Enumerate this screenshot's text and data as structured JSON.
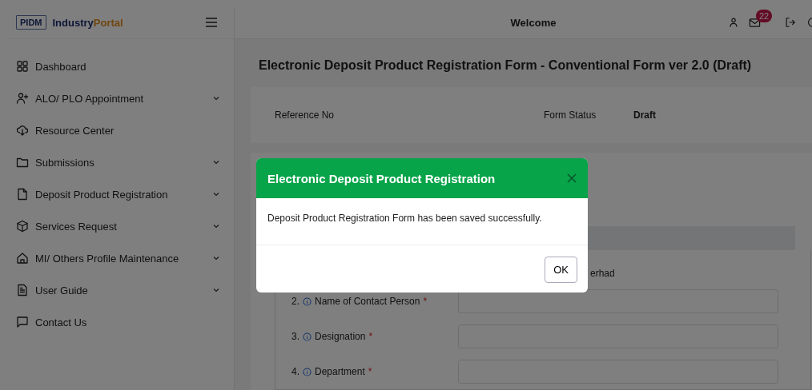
{
  "brand": {
    "mark": "PIDM",
    "name": "Industry",
    "accent": "Portal"
  },
  "header": {
    "welcome": "Welcome",
    "badge": "22"
  },
  "sidebar": {
    "items": [
      {
        "label": "Dashboard",
        "kind": "link"
      },
      {
        "label": "ALO/ PLO Appointment",
        "kind": "menu",
        "expanded": false
      },
      {
        "label": "Resource Center",
        "kind": "link"
      },
      {
        "label": "Submissions",
        "kind": "menu",
        "expanded": false
      },
      {
        "label": "Deposit Product Registration",
        "kind": "menu",
        "expanded": false
      },
      {
        "label": "Services Request",
        "kind": "menu",
        "expanded": false
      },
      {
        "label": "MI/ Others Profile Maintenance",
        "kind": "menu",
        "expanded": false
      },
      {
        "label": "User Guide",
        "kind": "menu",
        "expanded": false
      },
      {
        "label": "Contact Us",
        "kind": "link"
      }
    ]
  },
  "page": {
    "title": "Electronic Deposit Product Registration Form - Conventional Form ver 2.0 (Draft)",
    "reference_label": "Reference No",
    "status_label": "Form Status",
    "status_value": "Draft"
  },
  "form": {
    "rows": [
      {
        "kind": "partial",
        "value": "erhad"
      },
      {
        "kind": "field",
        "number": "2.",
        "label": "Name of Contact Person",
        "required_mark": "*"
      },
      {
        "kind": "field",
        "number": "3.",
        "label": "Designation",
        "required_mark": "*"
      },
      {
        "kind": "field",
        "number": "4.",
        "label": "Department",
        "required_mark": "*"
      }
    ]
  },
  "dialog": {
    "title": "Electronic Deposit Product Registration",
    "message": "Deposit Product Registration Form has been saved successfully.",
    "button": "OK"
  }
}
